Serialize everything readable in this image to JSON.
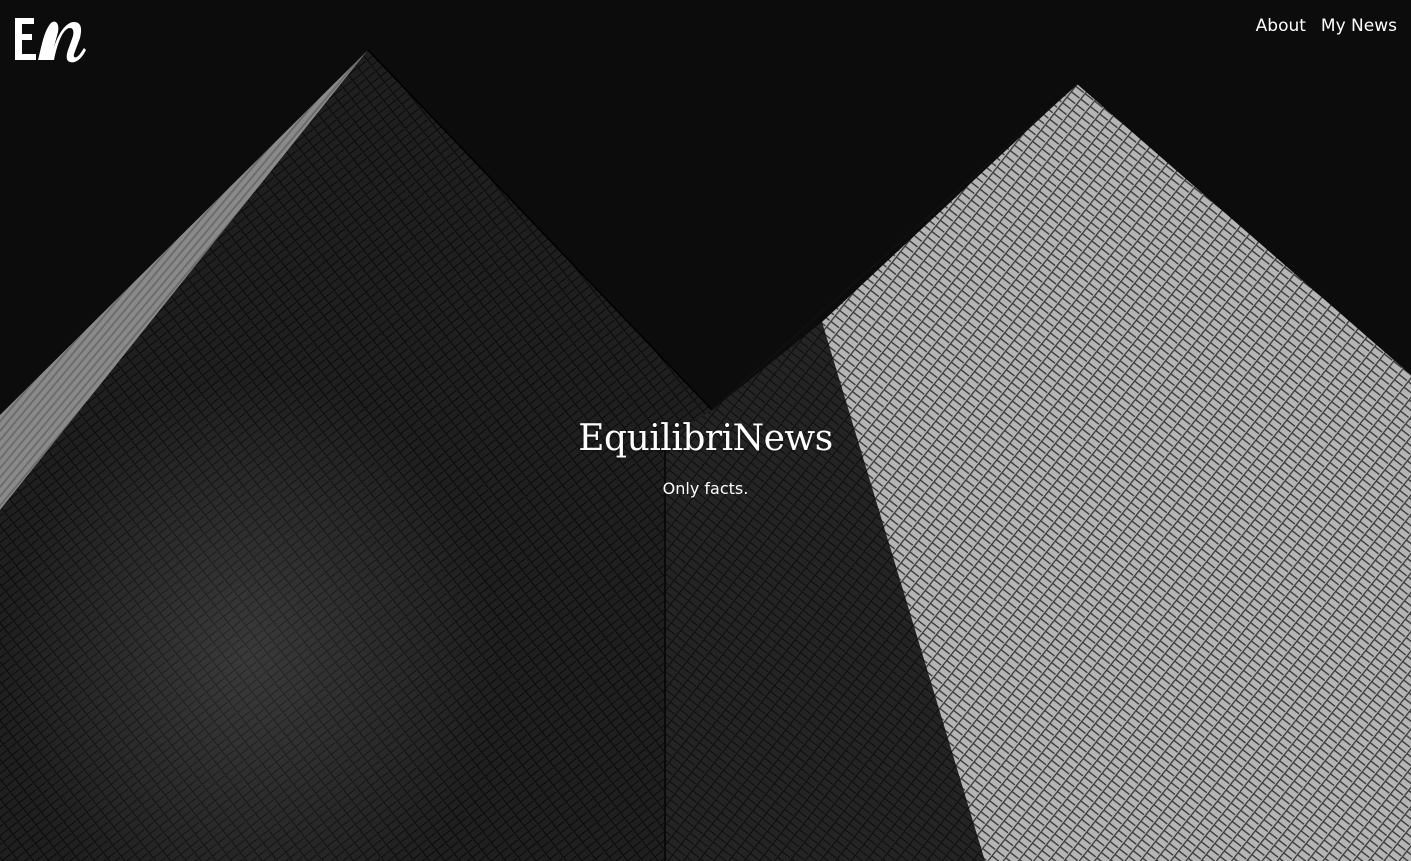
{
  "brand": {
    "logo_text": "En",
    "logo_icon": "en-monogram-logo"
  },
  "nav": {
    "items": [
      {
        "label": "About"
      },
      {
        "label": "My News"
      }
    ]
  },
  "hero": {
    "title": "EquilibriNews",
    "tagline": "Only facts."
  },
  "colors": {
    "background": "#0c0c0c",
    "text": "#ffffff"
  }
}
